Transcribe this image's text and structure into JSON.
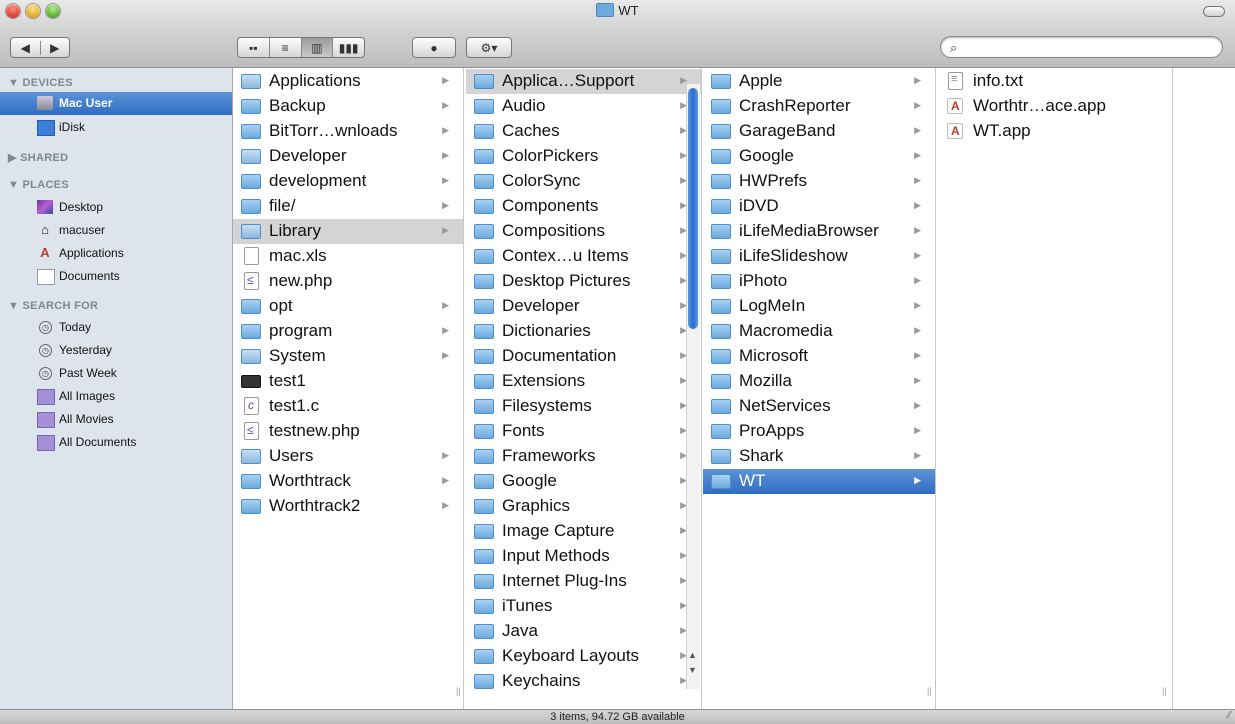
{
  "window": {
    "title": "WT"
  },
  "toolbar": {
    "back": "◀",
    "forward": "▶",
    "view_icons": "▪▪",
    "view_list": "≡",
    "view_columns": "▥",
    "view_coverflow": "▮▮▮",
    "quicklook": "●",
    "action": "⚙▾",
    "search_placeholder": ""
  },
  "sidebar": {
    "devices_header": "▼ DEVICES",
    "shared_header": "▶ SHARED",
    "places_header": "▼ PLACES",
    "search_header": "▼ SEARCH FOR",
    "devices": [
      {
        "label": "Mac User",
        "icon": "hard-drive-icon"
      },
      {
        "label": "iDisk",
        "icon": "idisk-icon"
      }
    ],
    "places": [
      {
        "label": "Desktop",
        "icon": "desktop-icon"
      },
      {
        "label": "macuser",
        "icon": "home-icon"
      },
      {
        "label": "Applications",
        "icon": "applications-icon"
      },
      {
        "label": "Documents",
        "icon": "documents-icon"
      }
    ],
    "search_for": [
      {
        "label": "Today",
        "icon": "clock-icon"
      },
      {
        "label": "Yesterday",
        "icon": "clock-icon"
      },
      {
        "label": "Past Week",
        "icon": "clock-icon"
      },
      {
        "label": "All Images",
        "icon": "smart-folder-icon"
      },
      {
        "label": "All Movies",
        "icon": "smart-folder-icon"
      },
      {
        "label": "All Documents",
        "icon": "smart-folder-icon"
      }
    ]
  },
  "columns": [
    {
      "items": [
        {
          "name": "Applications",
          "kind": "app",
          "arrow": true
        },
        {
          "name": "Backup",
          "kind": "folder",
          "arrow": true
        },
        {
          "name": "BitTorr…wnloads",
          "kind": "folder",
          "arrow": true
        },
        {
          "name": "Developer",
          "kind": "app",
          "arrow": true
        },
        {
          "name": "development",
          "kind": "folder",
          "arrow": true
        },
        {
          "name": "file/",
          "kind": "folder",
          "arrow": true
        },
        {
          "name": "Library",
          "kind": "app",
          "arrow": true,
          "selected": "gray"
        },
        {
          "name": "mac.xls",
          "kind": "doc",
          "arrow": false
        },
        {
          "name": "new.php",
          "kind": "php",
          "arrow": false
        },
        {
          "name": "opt",
          "kind": "folder",
          "arrow": true
        },
        {
          "name": "program",
          "kind": "folder",
          "arrow": true
        },
        {
          "name": "System",
          "kind": "app",
          "arrow": true
        },
        {
          "name": "test1",
          "kind": "term",
          "arrow": false
        },
        {
          "name": "test1.c",
          "kind": "cfile",
          "arrow": false
        },
        {
          "name": "testnew.php",
          "kind": "php",
          "arrow": false
        },
        {
          "name": "Users",
          "kind": "app",
          "arrow": true
        },
        {
          "name": "Worthtrack",
          "kind": "folder",
          "arrow": true
        },
        {
          "name": "Worthtrack2",
          "kind": "folder",
          "arrow": true
        }
      ]
    },
    {
      "items": [
        {
          "name": "Applica…Support",
          "kind": "folder",
          "arrow": true,
          "selected": "gray"
        },
        {
          "name": "Audio",
          "kind": "folder",
          "arrow": true
        },
        {
          "name": "Caches",
          "kind": "folder",
          "arrow": true
        },
        {
          "name": "ColorPickers",
          "kind": "folder",
          "arrow": true
        },
        {
          "name": "ColorSync",
          "kind": "folder",
          "arrow": true
        },
        {
          "name": "Components",
          "kind": "folder",
          "arrow": true
        },
        {
          "name": "Compositions",
          "kind": "folder",
          "arrow": true
        },
        {
          "name": "Contex…u Items",
          "kind": "folder",
          "arrow": true
        },
        {
          "name": "Desktop Pictures",
          "kind": "folder",
          "arrow": true
        },
        {
          "name": "Developer",
          "kind": "folder",
          "arrow": true
        },
        {
          "name": "Dictionaries",
          "kind": "folder",
          "arrow": true
        },
        {
          "name": "Documentation",
          "kind": "folder",
          "arrow": true
        },
        {
          "name": "Extensions",
          "kind": "folder",
          "arrow": true
        },
        {
          "name": "Filesystems",
          "kind": "folder",
          "arrow": true
        },
        {
          "name": "Fonts",
          "kind": "folder",
          "arrow": true
        },
        {
          "name": "Frameworks",
          "kind": "folder",
          "arrow": true
        },
        {
          "name": "Google",
          "kind": "folder",
          "arrow": true
        },
        {
          "name": "Graphics",
          "kind": "folder",
          "arrow": true
        },
        {
          "name": "Image Capture",
          "kind": "folder",
          "arrow": true
        },
        {
          "name": "Input Methods",
          "kind": "folder",
          "arrow": true
        },
        {
          "name": "Internet Plug-Ins",
          "kind": "folder",
          "arrow": true
        },
        {
          "name": "iTunes",
          "kind": "folder",
          "arrow": true
        },
        {
          "name": "Java",
          "kind": "folder",
          "arrow": true
        },
        {
          "name": "Keyboard Layouts",
          "kind": "folder",
          "arrow": true
        },
        {
          "name": "Keychains",
          "kind": "folder",
          "arrow": true
        }
      ]
    },
    {
      "items": [
        {
          "name": "Apple",
          "kind": "folder",
          "arrow": true
        },
        {
          "name": "CrashReporter",
          "kind": "folder",
          "arrow": true
        },
        {
          "name": "GarageBand",
          "kind": "folder",
          "arrow": true
        },
        {
          "name": "Google",
          "kind": "folder",
          "arrow": true
        },
        {
          "name": "HWPrefs",
          "kind": "folder",
          "arrow": true
        },
        {
          "name": "iDVD",
          "kind": "folder",
          "arrow": true
        },
        {
          "name": "iLifeMediaBrowser",
          "kind": "folder",
          "arrow": true
        },
        {
          "name": "iLifeSlideshow",
          "kind": "folder",
          "arrow": true
        },
        {
          "name": "iPhoto",
          "kind": "folder",
          "arrow": true
        },
        {
          "name": "LogMeIn",
          "kind": "folder",
          "arrow": true
        },
        {
          "name": "Macromedia",
          "kind": "folder",
          "arrow": true
        },
        {
          "name": "Microsoft",
          "kind": "folder",
          "arrow": true
        },
        {
          "name": "Mozilla",
          "kind": "folder",
          "arrow": true
        },
        {
          "name": "NetServices",
          "kind": "folder",
          "arrow": true
        },
        {
          "name": "ProApps",
          "kind": "folder",
          "arrow": true
        },
        {
          "name": "Shark",
          "kind": "folder",
          "arrow": true
        },
        {
          "name": "WT",
          "kind": "folder",
          "arrow": true,
          "selected": "blue"
        }
      ]
    },
    {
      "items": [
        {
          "name": "info.txt",
          "kind": "txt",
          "arrow": false
        },
        {
          "name": "Worthtr…ace.app",
          "kind": "appx",
          "arrow": false
        },
        {
          "name": "WT.app",
          "kind": "appx",
          "arrow": false
        }
      ]
    }
  ],
  "status": {
    "text": "3 items, 94.72 GB available"
  }
}
